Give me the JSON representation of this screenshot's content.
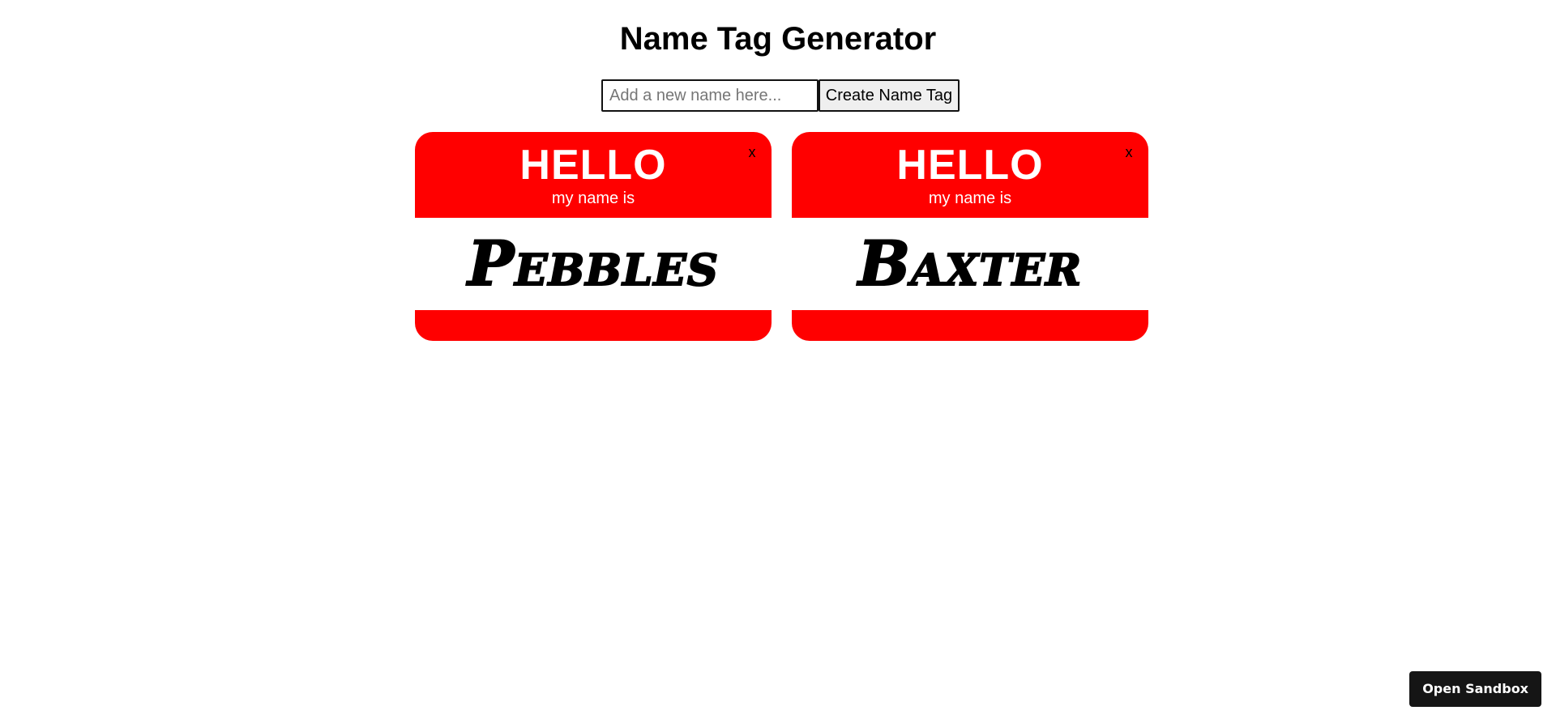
{
  "header": {
    "title": "Name Tag Generator"
  },
  "form": {
    "input_value": "",
    "input_placeholder": "Add a new name here...",
    "create_label": "Create Name Tag"
  },
  "tags": [
    {
      "hello": "HELLO",
      "subtitle": "my name is",
      "name": "Pebbles",
      "close_label": "x"
    },
    {
      "hello": "HELLO",
      "subtitle": "my name is",
      "name": "Baxter",
      "close_label": "x"
    }
  ],
  "footer": {
    "sandbox_label": "Open Sandbox"
  },
  "colors": {
    "tag_red": "#ff0000",
    "button_dark": "#151515"
  }
}
